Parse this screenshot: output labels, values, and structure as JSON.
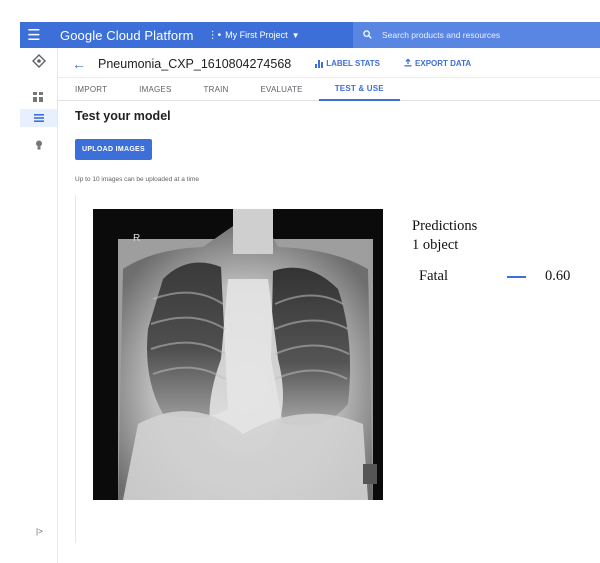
{
  "appbar": {
    "brand": "Google Cloud Platform",
    "project": "My First Project",
    "search_placeholder": "Search products and resources"
  },
  "header": {
    "dataset_name": "Pneumonia_CXP_1610804274568",
    "label_stats": "LABEL STATS",
    "export_data": "EXPORT DATA"
  },
  "tabs": [
    {
      "label": "IMPORT"
    },
    {
      "label": "IMAGES"
    },
    {
      "label": "TRAIN"
    },
    {
      "label": "EVALUATE"
    },
    {
      "label": "TEST & USE",
      "active": true
    }
  ],
  "main": {
    "heading": "Test your model",
    "upload_button": "UPLOAD IMAGES",
    "upload_hint": "Up to 10 images can be uploaded at a time"
  },
  "predictions": {
    "title": "Predictions",
    "count": "1 object",
    "items": [
      {
        "label": "Fatal",
        "score": 0.6,
        "score_text": "0.60"
      }
    ]
  },
  "colors": {
    "accent": "#3d6fd8",
    "search_bg": "#5a86e3"
  },
  "icons": [
    "menu-icon",
    "project-dots-icon",
    "caret-down-icon",
    "search-icon",
    "automl-logo-icon",
    "dashboard-icon",
    "list-icon",
    "lightbulb-icon",
    "back-arrow-icon",
    "bar-chart-icon",
    "export-icon",
    "expand-rail-icon"
  ]
}
